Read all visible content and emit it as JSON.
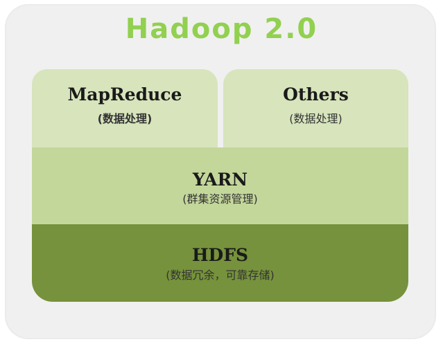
{
  "title": "Hadoop  2.0",
  "layers": {
    "mapreduce": {
      "label": "MapReduce",
      "sub": "(数据处理)"
    },
    "others": {
      "label": "Others",
      "sub": "(数据处理)"
    },
    "yarn": {
      "label": "YARN",
      "sub": "(群集资源管理)"
    },
    "hdfs": {
      "label": "HDFS",
      "sub": "(数据冗余，可靠存储)"
    }
  },
  "colors": {
    "title": "#92d050",
    "top_boxes": "#d7e4bc",
    "yarn": "#c4d79b",
    "hdfs": "#76923c",
    "background": "#f0f0f0"
  }
}
